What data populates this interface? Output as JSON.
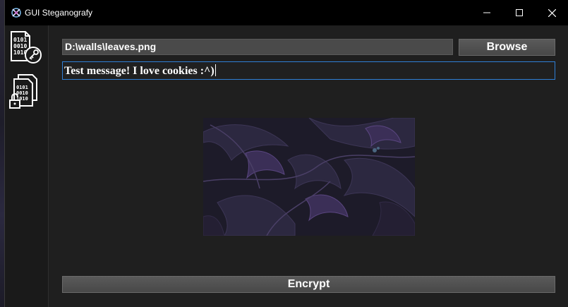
{
  "window": {
    "title": "GUI Steganografy",
    "icon": "app-logo-icon",
    "controls": [
      "minimize-icon",
      "maximize-icon",
      "close-icon"
    ]
  },
  "sidebar": {
    "items": [
      {
        "name": "encrypt",
        "icon": "binary-file-key-icon"
      },
      {
        "name": "decrypt",
        "icon": "binary-files-lock-icon"
      }
    ]
  },
  "form": {
    "file_path": "D:\\walls\\leaves.png",
    "browse_label": "Browse",
    "message": "Test message! I love cookies :^)"
  },
  "preview": {
    "image": "leaves-wallpaper-image"
  },
  "actions": {
    "encrypt_label": "Encrypt"
  },
  "colors": {
    "titlebar": "#000000",
    "background": "#1f1f1f",
    "input_focus_border": "#2f7fd6",
    "button": "#505050"
  }
}
